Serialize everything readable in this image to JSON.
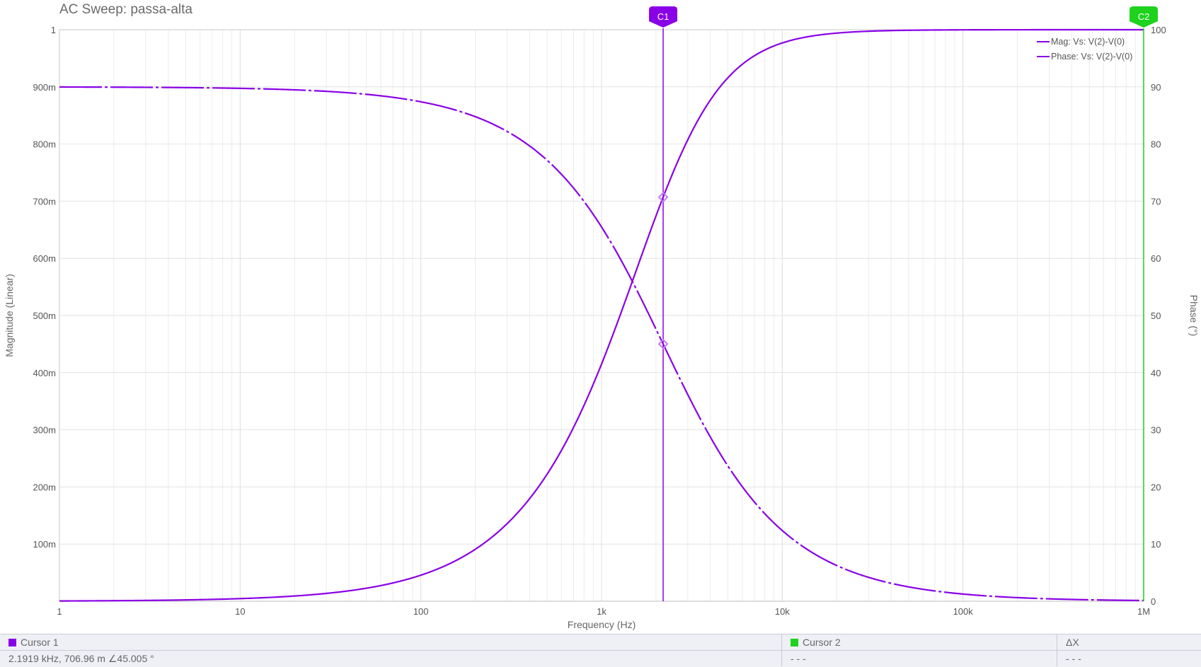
{
  "title": "AC Sweep: passa-alta",
  "chart_data": {
    "type": "line",
    "title": "AC Sweep: passa-alta",
    "xlabel": "Frequency (Hz)",
    "ylabel": "Magnitude (Linear)",
    "y2label": "Phase (°)",
    "xscale": "log",
    "xlim": [
      1,
      1000000
    ],
    "ylim": [
      0,
      1
    ],
    "y2lim": [
      0,
      100
    ],
    "grid": true,
    "legend_position": "top-right",
    "x_tick_values": [
      1,
      10,
      100,
      1000,
      10000,
      100000,
      1000000
    ],
    "x_tick_labels": [
      "1",
      "10",
      "100",
      "1k",
      "10k",
      "100k",
      "1M"
    ],
    "y_tick_values": [
      0.1,
      0.2,
      0.3,
      0.4,
      0.5,
      0.6,
      0.7,
      0.8,
      0.9,
      1
    ],
    "y_tick_labels": [
      "100m",
      "200m",
      "300m",
      "400m",
      "500m",
      "600m",
      "700m",
      "800m",
      "900m",
      "1"
    ],
    "y2_tick_values": [
      0,
      10,
      20,
      30,
      40,
      50,
      60,
      70,
      80,
      90,
      100
    ],
    "y2_tick_labels": [
      "0",
      "10",
      "20",
      "30",
      "40",
      "50",
      "60",
      "70",
      "80",
      "90",
      "100"
    ],
    "series": [
      {
        "name": "Mag: Vs: V(2)-V(0)",
        "axis": "left",
        "color": "#8a00e6",
        "style": "solid",
        "x": [
          1,
          10,
          30,
          100,
          200,
          300,
          500,
          700,
          1000,
          1500,
          2191.9,
          3000,
          5000,
          7000,
          10000,
          20000,
          50000,
          100000,
          1000000
        ],
        "y": [
          0.0005,
          0.0046,
          0.0137,
          0.0456,
          0.0909,
          0.136,
          0.222,
          0.304,
          0.415,
          0.565,
          0.707,
          0.807,
          0.916,
          0.954,
          0.977,
          0.994,
          0.999,
          1.0,
          1.0
        ]
      },
      {
        "name": "Phase: Vs: V(2)-V(0)",
        "axis": "right",
        "color": "#8a00e6",
        "style": "dash-dot",
        "x": [
          1,
          10,
          30,
          100,
          200,
          300,
          500,
          700,
          1000,
          1500,
          2191.9,
          3000,
          5000,
          7000,
          10000,
          20000,
          50000,
          100000,
          1000000
        ],
        "y": [
          89.97,
          89.74,
          89.2,
          87.4,
          84.8,
          82.2,
          77.2,
          72.5,
          65.5,
          55.6,
          45.0,
          36.2,
          23.7,
          17.4,
          12.4,
          6.3,
          2.5,
          1.26,
          0.13
        ]
      }
    ],
    "cursors": [
      {
        "name": "C1",
        "x": 2191.9,
        "color": "#8a00e6",
        "markers": [
          0.70696,
          45.005
        ]
      },
      {
        "name": "C2",
        "x": 1000000,
        "color": "#1ed21e"
      }
    ]
  },
  "cursor_table": {
    "headers": [
      "Cursor 1",
      "Cursor 2",
      "ΔX"
    ],
    "values": [
      "2.1919 kHz, 706.96 m ∠45.005 °",
      "- - -",
      "- - -"
    ],
    "colors": [
      "#8a00e6",
      "#1ed21e"
    ]
  }
}
